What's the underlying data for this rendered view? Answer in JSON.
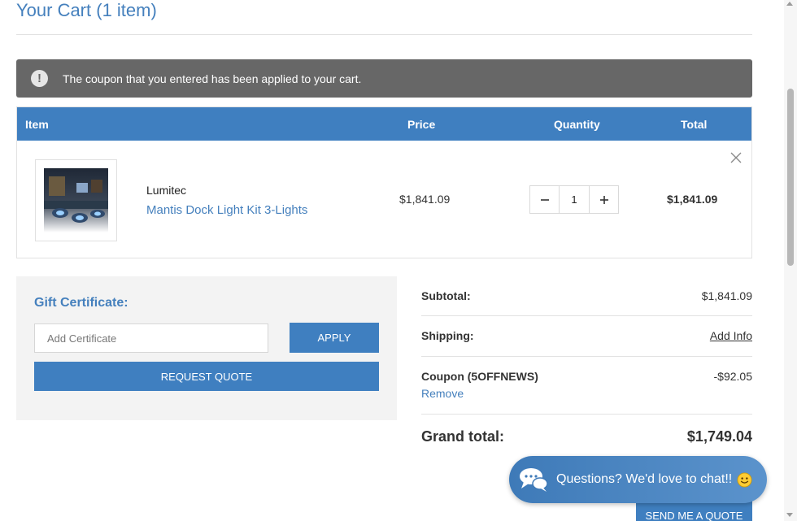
{
  "cart": {
    "title": "Your Cart (1 item)"
  },
  "alert": {
    "icon": "exclamation-icon",
    "icon_glyph": "!",
    "message": "The coupon that you entered has been applied to your cart."
  },
  "table": {
    "headers": {
      "item": "Item",
      "price": "Price",
      "quantity": "Quantity",
      "total": "Total"
    },
    "rows": [
      {
        "brand": "Lumitec",
        "name": "Mantis Dock Light Kit 3-Lights",
        "price": "$1,841.09",
        "quantity": "1",
        "total": "$1,841.09"
      }
    ]
  },
  "gift": {
    "title": "Gift Certificate:",
    "placeholder": "Add Certificate",
    "apply_label": "APPLY",
    "request_quote_label": "REQUEST QUOTE"
  },
  "summary": {
    "subtotal_label": "Subtotal:",
    "subtotal_value": "$1,841.09",
    "shipping_label": "Shipping:",
    "shipping_link": "Add Info",
    "coupon_label": "Coupon (5OFFNEWS)",
    "coupon_value": "-$92.05",
    "coupon_remove": "Remove",
    "grand_total_label": "Grand total:",
    "grand_total_value": "$1,749.04"
  },
  "actions": {
    "send_quote_label": "SEND ME A QUOTE"
  },
  "chat": {
    "text": "Questions? We'd love to chat!!"
  },
  "colors": {
    "accent": "#3f7fc0",
    "link": "#4580bd",
    "alert_bg": "#676767",
    "panel_bg": "#f3f3f3"
  }
}
